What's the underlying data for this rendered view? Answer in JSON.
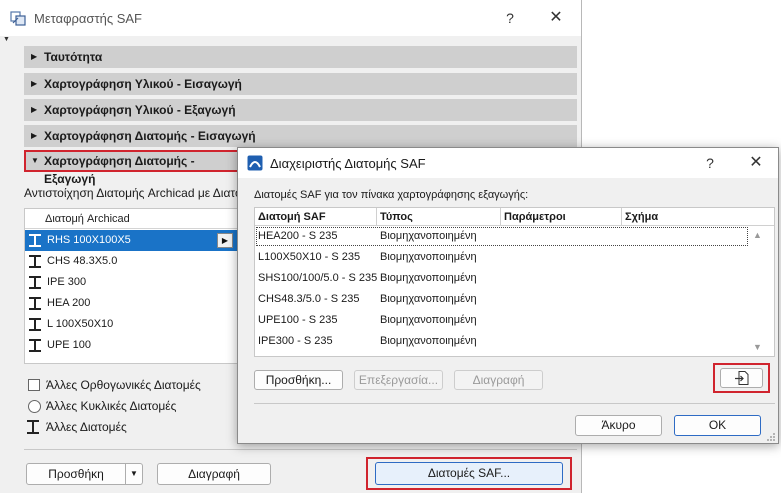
{
  "main_window": {
    "title": "Μεταφραστής SAF",
    "help": "?",
    "close": "✕",
    "sections": [
      {
        "label": "Ταυτότητα"
      },
      {
        "label": "Χαρτογράφηση Υλικού - Εισαγωγή"
      },
      {
        "label": "Χαρτογράφηση Υλικού - Εξαγωγή"
      },
      {
        "label": "Χαρτογράφηση Διατομής - Εισαγωγή"
      },
      {
        "label": "Χαρτογράφηση Διατομής - Εξαγωγή"
      }
    ],
    "mapping_description": "Αντιστοίχηση Διατομής Archicad με Διατομή SAF",
    "profile_list_header": "Διατομή Archicad",
    "profiles": [
      "RHS 100X100X5",
      "CHS 48.3X5.0",
      "IPE 300",
      "HEA 200",
      "L 100X50X10",
      "UPE 100"
    ],
    "options": {
      "rectangular": "Άλλες Ορθογωνικές Διατομές",
      "circular": "Άλλες Κυκλικές Διατομές",
      "other": "Άλλες Διατομές"
    },
    "buttons": {
      "add": "Προσθήκη",
      "delete": "Διαγραφή",
      "saf_profiles": "Διατομές SAF..."
    }
  },
  "saf_dialog": {
    "title": "Διαχειριστής Διατομής SAF",
    "help": "?",
    "close": "✕",
    "description": "Διατομές SAF για τον πίνακα χαρτογράφησης εξαγωγής:",
    "columns": [
      "Διατομή SAF",
      "Τύπος",
      "Παράμετροι",
      "Σχήμα"
    ],
    "rows": [
      {
        "name": "HEA200 - S 235",
        "type": "Βιομηχανοποιημένη"
      },
      {
        "name": "L100X50X10 - S 235",
        "type": "Βιομηχανοποιημένη"
      },
      {
        "name": "SHS100/100/5.0 - S 235",
        "type": "Βιομηχανοποιημένη"
      },
      {
        "name": "CHS48.3/5.0 - S 235",
        "type": "Βιομηχανοποιημένη"
      },
      {
        "name": "UPE100 - S 235",
        "type": "Βιομηχανοποιημένη"
      },
      {
        "name": "IPE300 - S 235",
        "type": "Βιομηχανοποιημένη"
      }
    ],
    "buttons": {
      "add": "Προσθήκη...",
      "edit": "Επεξεργασία...",
      "delete": "Διαγραφή",
      "cancel": "Άκυρο",
      "ok": "OK"
    }
  },
  "colors": {
    "highlight_border": "#d0242e",
    "selection": "#1a73c7",
    "section_bg": "#cfcfcf"
  },
  "icons": [
    "saf-translator-icon",
    "profile-icon",
    "import-icon",
    "saf-manager-icon"
  ]
}
